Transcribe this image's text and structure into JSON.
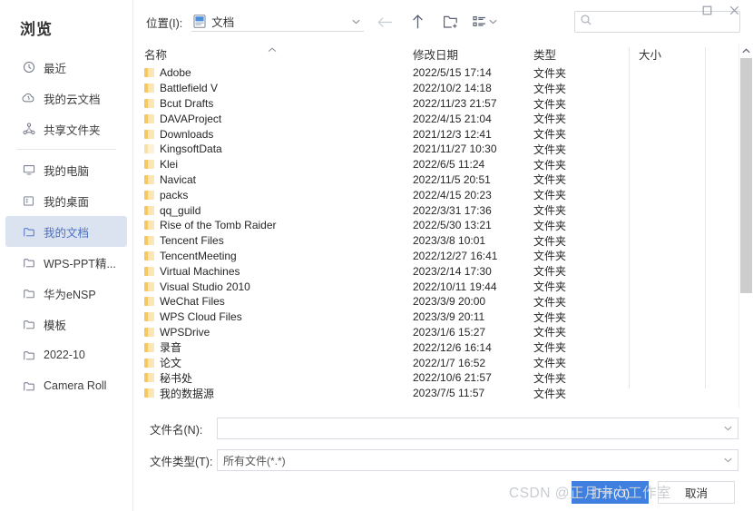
{
  "window": {
    "maximize_label": "maximize",
    "close_label": "close"
  },
  "sidebar": {
    "title": "浏览",
    "groups": [
      {
        "items": [
          {
            "label": "最近",
            "icon": "clock-icon",
            "selected": false
          },
          {
            "label": "我的云文档",
            "icon": "cloud-icon",
            "selected": false
          },
          {
            "label": "共享文件夹",
            "icon": "share-nodes-icon",
            "selected": false
          }
        ]
      },
      {
        "items": [
          {
            "label": "我的电脑",
            "icon": "monitor-icon",
            "selected": false
          },
          {
            "label": "我的桌面",
            "icon": "desktop-icon",
            "selected": false
          },
          {
            "label": "我的文档",
            "icon": "folder-icon",
            "selected": true
          },
          {
            "label": "WPS-PPT精...",
            "icon": "folder-icon",
            "selected": false
          },
          {
            "label": "华为eNSP",
            "icon": "folder-icon",
            "selected": false
          },
          {
            "label": "模板",
            "icon": "folder-icon",
            "selected": false
          },
          {
            "label": "2022-10",
            "icon": "folder-icon",
            "selected": false
          },
          {
            "label": "Camera Roll",
            "icon": "folder-icon",
            "selected": false
          }
        ]
      }
    ]
  },
  "toolbar": {
    "location_label": "位置(I):",
    "location_value": "文档",
    "back_title": "back",
    "up_title": "up",
    "new_folder_title": "new-folder",
    "view_title": "view-options",
    "search_placeholder": "",
    "search_value": ""
  },
  "file_list": {
    "columns": [
      {
        "key": "name",
        "label": "名称",
        "sorted": true,
        "sort_dir": "asc"
      },
      {
        "key": "date",
        "label": "修改日期"
      },
      {
        "key": "type",
        "label": "类型"
      },
      {
        "key": "size",
        "label": "大小"
      }
    ],
    "rows": [
      {
        "name": "Adobe",
        "date": "2022/5/15 17:14",
        "type": "文件夹",
        "size": ""
      },
      {
        "name": "Battlefield V",
        "date": "2022/10/2 14:18",
        "type": "文件夹",
        "size": ""
      },
      {
        "name": "Bcut Drafts",
        "date": "2022/11/23 21:57",
        "type": "文件夹",
        "size": ""
      },
      {
        "name": "DAVAProject",
        "date": "2022/4/15 21:04",
        "type": "文件夹",
        "size": ""
      },
      {
        "name": "Downloads",
        "date": "2021/12/3 12:41",
        "type": "文件夹",
        "size": ""
      },
      {
        "name": "KingsoftData",
        "date": "2021/11/27 10:30",
        "type": "文件夹",
        "size": "",
        "pale": true
      },
      {
        "name": "Klei",
        "date": "2022/6/5 11:24",
        "type": "文件夹",
        "size": ""
      },
      {
        "name": "Navicat",
        "date": "2022/11/5 20:51",
        "type": "文件夹",
        "size": ""
      },
      {
        "name": "packs",
        "date": "2022/4/15 20:23",
        "type": "文件夹",
        "size": ""
      },
      {
        "name": "qq_guild",
        "date": "2022/3/31 17:36",
        "type": "文件夹",
        "size": ""
      },
      {
        "name": "Rise of the Tomb Raider",
        "date": "2022/5/30 13:21",
        "type": "文件夹",
        "size": ""
      },
      {
        "name": "Tencent Files",
        "date": "2023/3/8 10:01",
        "type": "文件夹",
        "size": ""
      },
      {
        "name": "TencentMeeting",
        "date": "2022/12/27 16:41",
        "type": "文件夹",
        "size": ""
      },
      {
        "name": "Virtual Machines",
        "date": "2023/2/14 17:30",
        "type": "文件夹",
        "size": ""
      },
      {
        "name": "Visual Studio 2010",
        "date": "2022/10/11 19:44",
        "type": "文件夹",
        "size": ""
      },
      {
        "name": "WeChat Files",
        "date": "2023/3/9 20:00",
        "type": "文件夹",
        "size": ""
      },
      {
        "name": "WPS Cloud Files",
        "date": "2023/3/9 20:11",
        "type": "文件夹",
        "size": ""
      },
      {
        "name": "WPSDrive",
        "date": "2023/1/6 15:27",
        "type": "文件夹",
        "size": ""
      },
      {
        "name": "录音",
        "date": "2022/12/6 16:14",
        "type": "文件夹",
        "size": ""
      },
      {
        "name": "论文",
        "date": "2022/1/7 16:52",
        "type": "文件夹",
        "size": ""
      },
      {
        "name": "秘书处",
        "date": "2022/10/6 21:57",
        "type": "文件夹",
        "size": ""
      },
      {
        "name": "我的数据源",
        "date": "2023/7/5 11:57",
        "type": "文件夹",
        "size": ""
      }
    ]
  },
  "bottom": {
    "filename_label": "文件名(N):",
    "filename_value": "",
    "filetype_label": "文件类型(T):",
    "filetype_value": "所有文件(*.*)",
    "open_button": "打开(O)",
    "open_button_prefix": "打开(",
    "open_button_key": "O",
    "open_button_suffix": ")",
    "cancel_button": "取消"
  },
  "watermark": {
    "text": "CSDN @正月十六工作室"
  }
}
